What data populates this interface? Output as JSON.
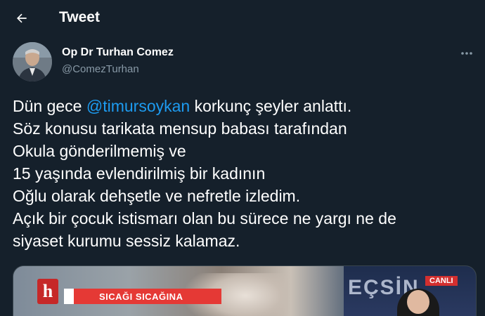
{
  "header": {
    "title": "Tweet",
    "back_icon": "arrow-left-icon"
  },
  "author": {
    "display_name": "Op Dr Turhan Comez",
    "handle": "@ComezTurhan",
    "avatar": "avatar-photo",
    "more_icon": "more-horizontal-icon"
  },
  "tweet": {
    "line1_pre": "Dün gece ",
    "mention": "@timursoykan",
    "line1_post": " korkunç şeyler anlattı.",
    "line2": "Söz konusu tarikata mensup babası tarafından",
    "line3": "Okula gönderilmemiş ve",
    "line4": "15 yaşında evlendirilmiş bir kadının",
    "line5": "Oğlu olarak dehşetle ve nefretle izledim.",
    "line6": "Açık bir çocuk istismarı olan bu sürece ne yargı ne de",
    "line7": "siyaset kurumu sessiz kalamaz."
  },
  "media": {
    "logo_letter": "h",
    "banner_text": "SICAĞI SICAĞINA",
    "studio_text": "EÇSİN",
    "live_label": "CANLI"
  },
  "colors": {
    "background": "#15202b",
    "mention": "#1d9bf0",
    "secondary_text": "#8899a6",
    "banner_red": "#e53935"
  }
}
